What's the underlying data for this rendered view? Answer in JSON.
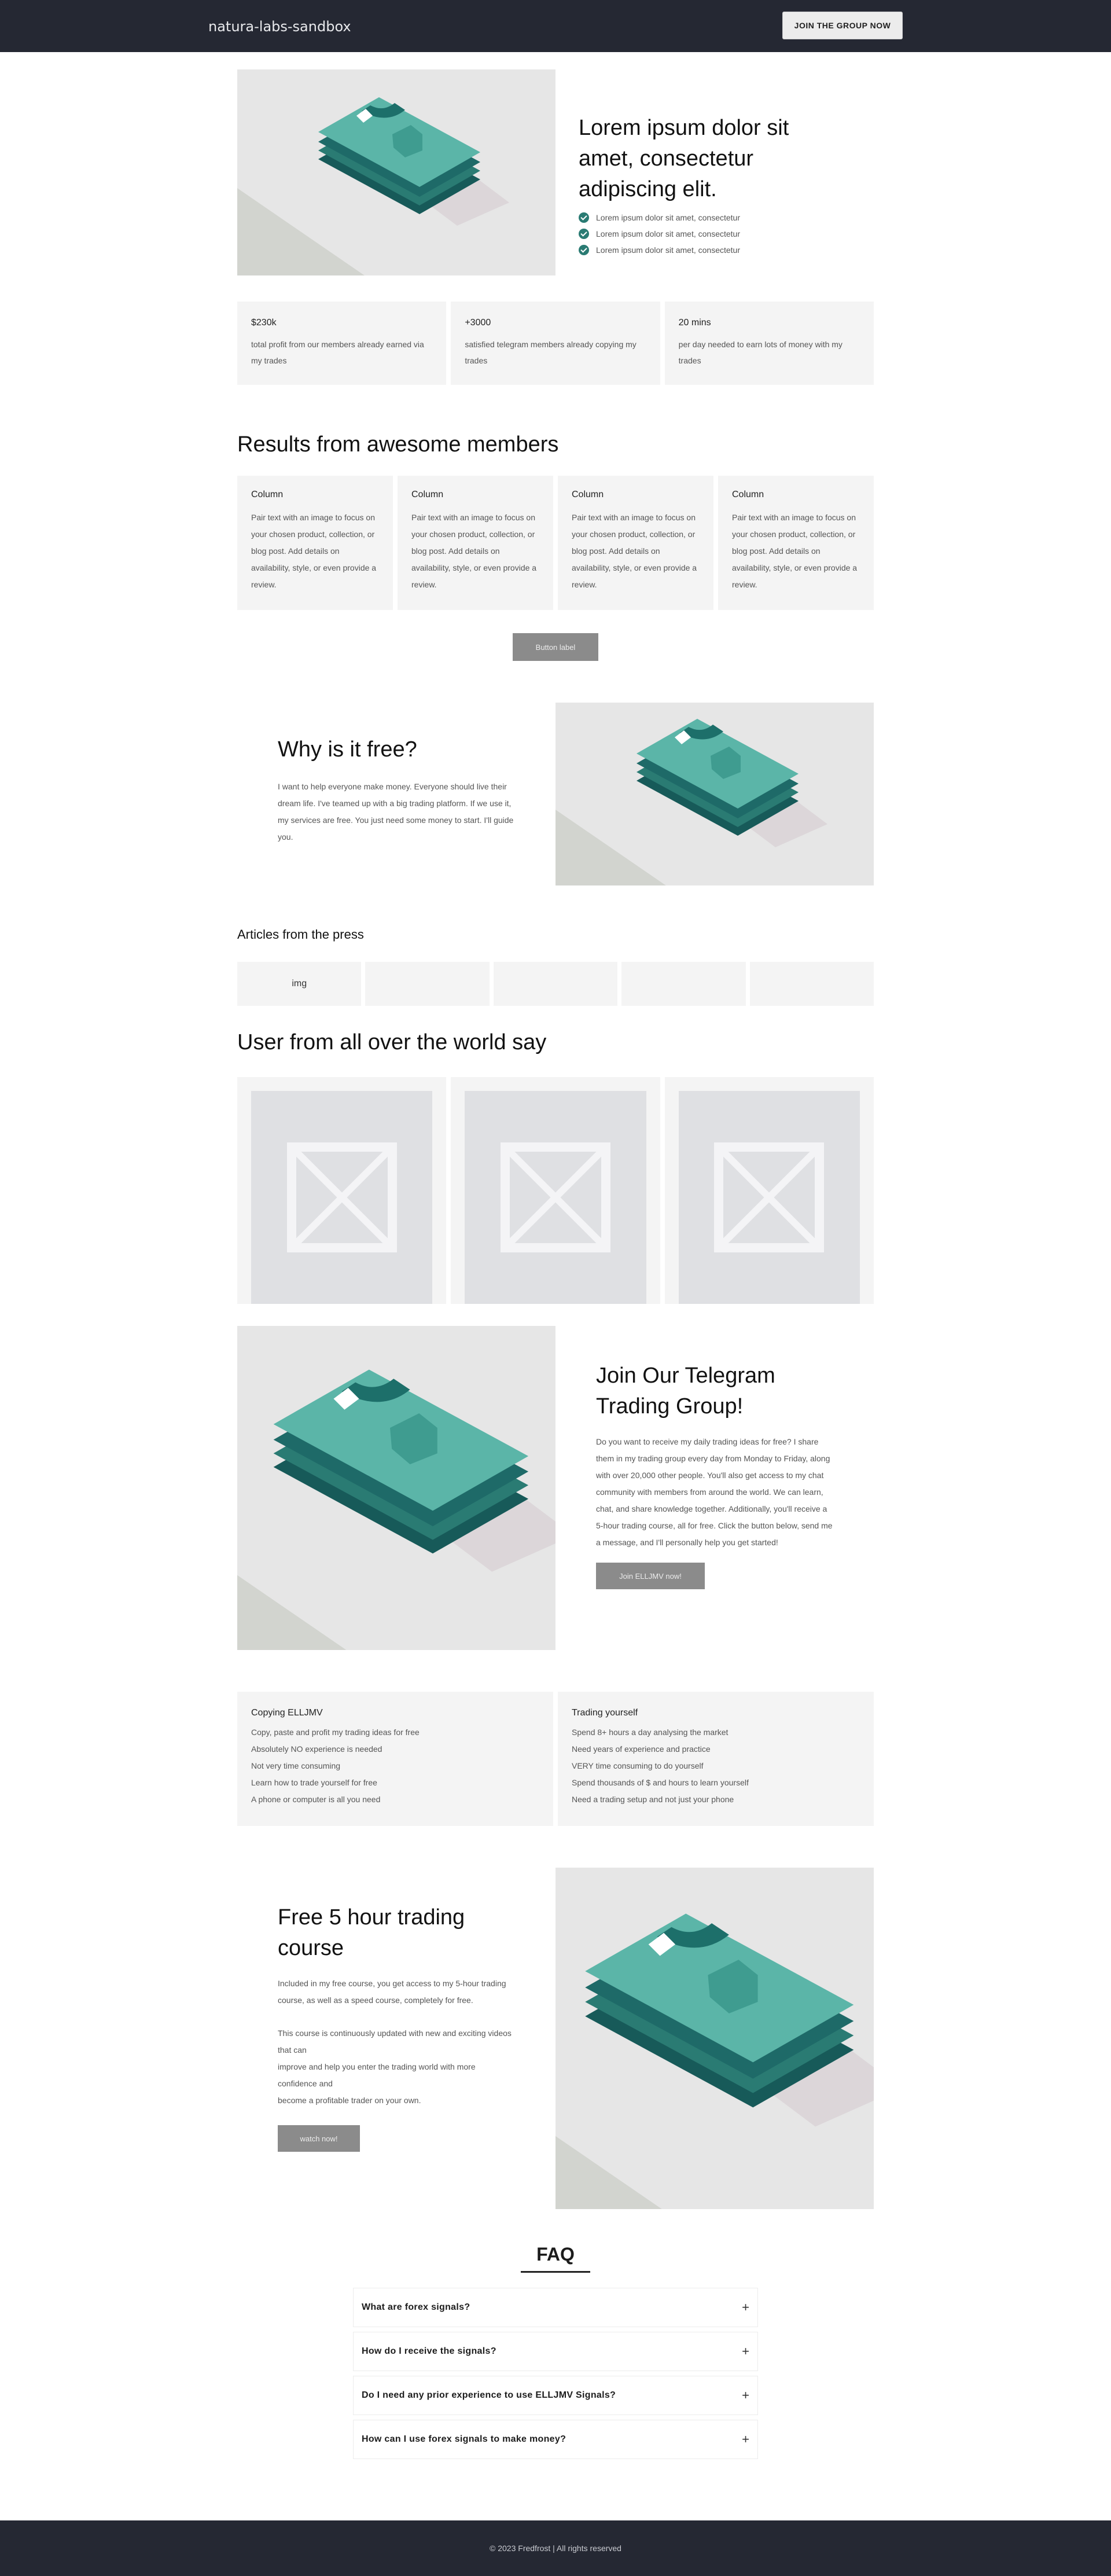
{
  "header": {
    "brand": "natura-labs-sandbox",
    "cta_label": "JOIN THE GROUP NOW"
  },
  "hero": {
    "title": "Lorem ipsum dolor sit amet, consectetur adipiscing elit.",
    "checklist": [
      "Lorem ipsum dolor sit amet, consectetur",
      "Lorem ipsum dolor sit amet, consectetur",
      "Lorem ipsum dolor sit amet, consectetur"
    ],
    "image_icon": "stacked-shirts-illustration"
  },
  "stats": [
    {
      "value": "$230k",
      "desc": "total profit from our members already earned via my trades"
    },
    {
      "value": "+3000",
      "desc": "satisfied telegram members already copying my trades"
    },
    {
      "value": "20 mins",
      "desc": "per day needed to earn lots of money with my trades"
    }
  ],
  "results": {
    "title": "Results from awesome members",
    "columns": [
      {
        "title": "Column",
        "text": "Pair text with an image to focus on your chosen product, collection, or blog post. Add details on availability, style, or even provide a review."
      },
      {
        "title": "Column",
        "text": "Pair text with an image to focus on your chosen product, collection, or blog post. Add details on availability, style, or even provide a review."
      },
      {
        "title": "Column",
        "text": "Pair text with an image to focus on your chosen product, collection, or blog post. Add details on availability, style, or even provide a review."
      },
      {
        "title": "Column",
        "text": "Pair text with an image to focus on your chosen product, collection, or blog post. Add details on availability, style, or even provide a review."
      }
    ],
    "button_label": "Button label"
  },
  "why": {
    "title": "Why is it free?",
    "text": "I want to help everyone make money. Everyone should live their dream life. I've teamed up with a big trading platform. If we use it, my services are free. You just need some money to start. I'll guide you."
  },
  "press": {
    "title": "Articles from the press",
    "items": [
      "img",
      "",
      "",
      "",
      ""
    ]
  },
  "testimonials": {
    "title": "User from all over the world say",
    "placeholder_icon": "image-placeholder-icon"
  },
  "telegram": {
    "title": "Join Our Telegram Trading Group!",
    "text": "Do you want to receive my daily trading ideas for free? I share them in my trading group every day from Monday to Friday, along with over 20,000 other people. You'll also get access to my chat community with members from around the world. We can learn, chat, and share knowledge together. Additionally, you'll receive a 5-hour trading course, all for free. Click the button below, send me a message, and I'll personally help you get started!",
    "button_label": "Join ELLJMV now!"
  },
  "compare": [
    {
      "title": "Copying ELLJMV",
      "lines": [
        "Copy, paste and profit my trading ideas for free",
        "Absolutely NO experience is needed",
        "Not very time consuming",
        "Learn how to trade yourself for free",
        "A phone or computer is all you need"
      ]
    },
    {
      "title": "Trading yourself",
      "lines": [
        "Spend 8+ hours a day analysing the market",
        "Need years of experience and practice",
        "VERY time consuming to do yourself",
        "Spend thousands of $ and hours to learn yourself",
        "Need a trading setup and not just your phone"
      ]
    }
  ],
  "course": {
    "title": "Free 5 hour trading course",
    "para1": "Included in my free course, you get access to my 5-hour trading course, as well as a speed course, completely for free.",
    "para2_lines": [
      "This course is continuously updated with new and exciting videos that can",
      "improve and help you enter the trading world with more confidence and",
      "become a profitable trader on your own."
    ],
    "button_label": "watch now!"
  },
  "faq": {
    "title": "FAQ",
    "items": [
      "What are forex signals?",
      "How do I receive the signals?",
      "Do I need any prior experience to use ELLJMV Signals?",
      "How can I use forex signals to make money?"
    ],
    "icon": "plus-icon"
  },
  "footer": {
    "text": "© 2023 Fredfrost | All rights reserved"
  },
  "colors": {
    "header_bg": "#252833",
    "teal": "#5bb5a8",
    "teal_dark": "#1f6d6a",
    "card_bg": "#f4f4f4",
    "button_gray": "#8b8b8b"
  }
}
